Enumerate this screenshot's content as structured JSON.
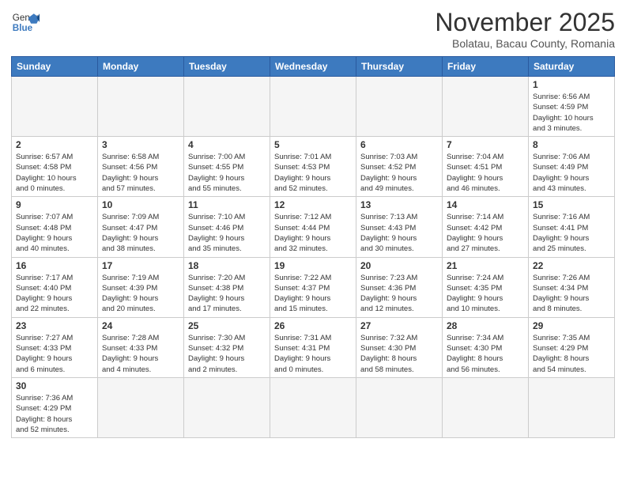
{
  "header": {
    "logo_general": "General",
    "logo_blue": "Blue",
    "title": "November 2025",
    "subtitle": "Bolatau, Bacau County, Romania"
  },
  "calendar": {
    "days_of_week": [
      "Sunday",
      "Monday",
      "Tuesday",
      "Wednesday",
      "Thursday",
      "Friday",
      "Saturday"
    ],
    "weeks": [
      [
        {
          "day": "",
          "info": ""
        },
        {
          "day": "",
          "info": ""
        },
        {
          "day": "",
          "info": ""
        },
        {
          "day": "",
          "info": ""
        },
        {
          "day": "",
          "info": ""
        },
        {
          "day": "",
          "info": ""
        },
        {
          "day": "1",
          "info": "Sunrise: 6:56 AM\nSunset: 4:59 PM\nDaylight: 10 hours\nand 3 minutes."
        }
      ],
      [
        {
          "day": "2",
          "info": "Sunrise: 6:57 AM\nSunset: 4:58 PM\nDaylight: 10 hours\nand 0 minutes."
        },
        {
          "day": "3",
          "info": "Sunrise: 6:58 AM\nSunset: 4:56 PM\nDaylight: 9 hours\nand 57 minutes."
        },
        {
          "day": "4",
          "info": "Sunrise: 7:00 AM\nSunset: 4:55 PM\nDaylight: 9 hours\nand 55 minutes."
        },
        {
          "day": "5",
          "info": "Sunrise: 7:01 AM\nSunset: 4:53 PM\nDaylight: 9 hours\nand 52 minutes."
        },
        {
          "day": "6",
          "info": "Sunrise: 7:03 AM\nSunset: 4:52 PM\nDaylight: 9 hours\nand 49 minutes."
        },
        {
          "day": "7",
          "info": "Sunrise: 7:04 AM\nSunset: 4:51 PM\nDaylight: 9 hours\nand 46 minutes."
        },
        {
          "day": "8",
          "info": "Sunrise: 7:06 AM\nSunset: 4:49 PM\nDaylight: 9 hours\nand 43 minutes."
        }
      ],
      [
        {
          "day": "9",
          "info": "Sunrise: 7:07 AM\nSunset: 4:48 PM\nDaylight: 9 hours\nand 40 minutes."
        },
        {
          "day": "10",
          "info": "Sunrise: 7:09 AM\nSunset: 4:47 PM\nDaylight: 9 hours\nand 38 minutes."
        },
        {
          "day": "11",
          "info": "Sunrise: 7:10 AM\nSunset: 4:46 PM\nDaylight: 9 hours\nand 35 minutes."
        },
        {
          "day": "12",
          "info": "Sunrise: 7:12 AM\nSunset: 4:44 PM\nDaylight: 9 hours\nand 32 minutes."
        },
        {
          "day": "13",
          "info": "Sunrise: 7:13 AM\nSunset: 4:43 PM\nDaylight: 9 hours\nand 30 minutes."
        },
        {
          "day": "14",
          "info": "Sunrise: 7:14 AM\nSunset: 4:42 PM\nDaylight: 9 hours\nand 27 minutes."
        },
        {
          "day": "15",
          "info": "Sunrise: 7:16 AM\nSunset: 4:41 PM\nDaylight: 9 hours\nand 25 minutes."
        }
      ],
      [
        {
          "day": "16",
          "info": "Sunrise: 7:17 AM\nSunset: 4:40 PM\nDaylight: 9 hours\nand 22 minutes."
        },
        {
          "day": "17",
          "info": "Sunrise: 7:19 AM\nSunset: 4:39 PM\nDaylight: 9 hours\nand 20 minutes."
        },
        {
          "day": "18",
          "info": "Sunrise: 7:20 AM\nSunset: 4:38 PM\nDaylight: 9 hours\nand 17 minutes."
        },
        {
          "day": "19",
          "info": "Sunrise: 7:22 AM\nSunset: 4:37 PM\nDaylight: 9 hours\nand 15 minutes."
        },
        {
          "day": "20",
          "info": "Sunrise: 7:23 AM\nSunset: 4:36 PM\nDaylight: 9 hours\nand 12 minutes."
        },
        {
          "day": "21",
          "info": "Sunrise: 7:24 AM\nSunset: 4:35 PM\nDaylight: 9 hours\nand 10 minutes."
        },
        {
          "day": "22",
          "info": "Sunrise: 7:26 AM\nSunset: 4:34 PM\nDaylight: 9 hours\nand 8 minutes."
        }
      ],
      [
        {
          "day": "23",
          "info": "Sunrise: 7:27 AM\nSunset: 4:33 PM\nDaylight: 9 hours\nand 6 minutes."
        },
        {
          "day": "24",
          "info": "Sunrise: 7:28 AM\nSunset: 4:33 PM\nDaylight: 9 hours\nand 4 minutes."
        },
        {
          "day": "25",
          "info": "Sunrise: 7:30 AM\nSunset: 4:32 PM\nDaylight: 9 hours\nand 2 minutes."
        },
        {
          "day": "26",
          "info": "Sunrise: 7:31 AM\nSunset: 4:31 PM\nDaylight: 9 hours\nand 0 minutes."
        },
        {
          "day": "27",
          "info": "Sunrise: 7:32 AM\nSunset: 4:30 PM\nDaylight: 8 hours\nand 58 minutes."
        },
        {
          "day": "28",
          "info": "Sunrise: 7:34 AM\nSunset: 4:30 PM\nDaylight: 8 hours\nand 56 minutes."
        },
        {
          "day": "29",
          "info": "Sunrise: 7:35 AM\nSunset: 4:29 PM\nDaylight: 8 hours\nand 54 minutes."
        }
      ],
      [
        {
          "day": "30",
          "info": "Sunrise: 7:36 AM\nSunset: 4:29 PM\nDaylight: 8 hours\nand 52 minutes."
        },
        {
          "day": "",
          "info": ""
        },
        {
          "day": "",
          "info": ""
        },
        {
          "day": "",
          "info": ""
        },
        {
          "day": "",
          "info": ""
        },
        {
          "day": "",
          "info": ""
        },
        {
          "day": "",
          "info": ""
        }
      ]
    ]
  }
}
